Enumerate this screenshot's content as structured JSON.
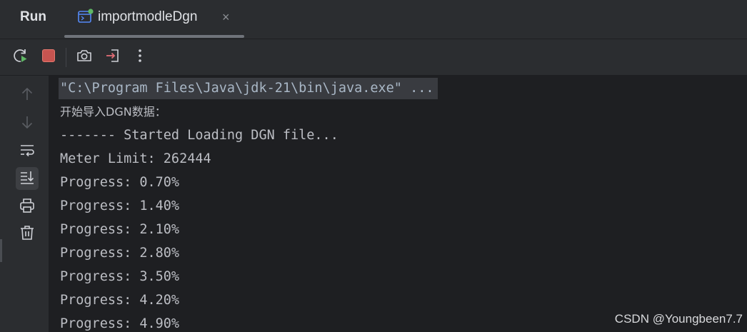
{
  "panel": {
    "title": "Run"
  },
  "tab": {
    "label": "importmodleDgn",
    "close_glyph": "×",
    "icon": "application-config-icon"
  },
  "toolbar": {
    "buttons": [
      {
        "name": "rerun-button",
        "icon": "rerun-icon"
      },
      {
        "name": "stop-button",
        "icon": "stop-icon",
        "color": "#c75450"
      },
      {
        "name": "screenshot-button",
        "icon": "camera-icon"
      },
      {
        "name": "exit-button",
        "icon": "exit-icon",
        "color": "#e06c75"
      },
      {
        "name": "more-button",
        "icon": "more-vertical-icon"
      }
    ]
  },
  "gutter": {
    "buttons": [
      {
        "name": "scroll-up-button",
        "icon": "arrow-up-icon"
      },
      {
        "name": "scroll-down-button",
        "icon": "arrow-down-icon"
      },
      {
        "name": "soft-wrap-button",
        "icon": "soft-wrap-icon"
      },
      {
        "name": "scroll-to-end-button",
        "icon": "scroll-to-end-icon",
        "active": true
      },
      {
        "name": "print-button",
        "icon": "printer-icon"
      },
      {
        "name": "clear-all-button",
        "icon": "trash-icon"
      }
    ]
  },
  "console": {
    "lines": [
      "\"C:\\Program Files\\Java\\jdk-21\\bin\\java.exe\" ...",
      "开始导入DGN数据：",
      "------- Started Loading DGN file...",
      "Meter Limit: 262444",
      "Progress: 0.70%",
      "Progress: 1.40%",
      "Progress: 2.10%",
      "Progress: 2.80%",
      "Progress: 3.50%",
      "Progress: 4.20%",
      "Progress: 4.90%"
    ]
  },
  "watermark": "CSDN @Youngbeen7.7",
  "colors": {
    "background": "#2b2d30",
    "console_background": "#1e1f22",
    "console_text": "#bcbec4",
    "accent_stop": "#c75450",
    "accent_run": "#5fb865"
  }
}
